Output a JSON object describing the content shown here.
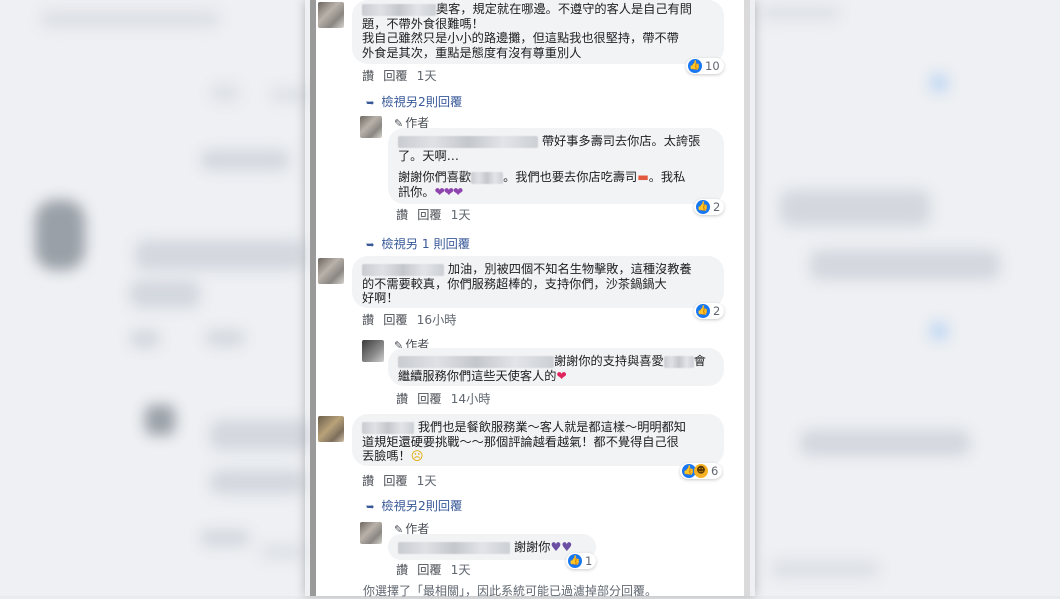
{
  "comments": [
    {
      "text_lines": [
        "奧客，規定就在哪邊。不遵守的客人是自己有問",
        "題，不帶外食很難嗎！",
        "我自己雖然只是小小的路邊攤，但這點我也很堅持，帶不帶",
        "外食是其次，重點是態度有沒有尊重別人"
      ],
      "actions": {
        "like": "讚",
        "reply": "回覆",
        "time": "1天"
      },
      "reaction_count": "10",
      "view_more": "檢視另2則回覆",
      "reply": {
        "author_label": "作者",
        "text_a": "帶好事多壽司去你店。太誇張",
        "text_b": "了。天啊…",
        "text_c": "謝謝你們喜歡",
        "text_d": "。我們也要去你店吃壽司",
        "text_e": "。我私",
        "text_f": "訊你。",
        "actions": {
          "like": "讚",
          "reply": "回覆",
          "time": "1天"
        },
        "reaction_count": "2"
      }
    },
    {
      "text_lines": [
        "加油，別被四個不知名生物擊敗，這種沒教養",
        "的不需要較真，你們服務超棒的，支持你們，沙茶鍋鍋大",
        "好啊！"
      ],
      "actions": {
        "like": "讚",
        "reply": "回覆",
        "time": "16小時"
      },
      "reaction_count": "2",
      "view_more": "檢視另 1 則回覆",
      "reply": {
        "author_label": "作者",
        "text_a": "謝謝你的支持與喜愛",
        "text_a2": "會",
        "text_b": "繼續服務你們這些天使客人的",
        "actions": {
          "like": "讚",
          "reply": "回覆",
          "time": "14小時"
        }
      }
    },
    {
      "text_lines": [
        "我們也是餐飲服務業～客人就是都這樣～明明都知",
        "道規矩還硬要挑戰～～那個評論越看越氣！都不覺得自己很",
        "丟臉嗎！"
      ],
      "actions": {
        "like": "讚",
        "reply": "回覆",
        "time": "1天"
      },
      "reaction_count": "6",
      "view_more": "檢視另2則回覆",
      "reply": {
        "author_label": "作者",
        "text_a": "謝謝你",
        "actions": {
          "like": "讚",
          "reply": "回覆",
          "time": "1天"
        },
        "reaction_count": "1"
      }
    }
  ],
  "footer_text": "你選擇了「最相關」，因此系統可能已過濾掉部分回覆。",
  "icons": {
    "like": "like-icon",
    "haha": "haha-icon",
    "pen": "pencil-icon",
    "arrow": "reply-arrow-icon",
    "heart": "heart-icon",
    "purple_hearts": "purple-heart-icon",
    "sushi": "sushi-icon",
    "emoji": "emoji-face-icon",
    "cats": "cat-emoji-icon"
  },
  "colors": {
    "link": "#385898",
    "like_blue": "#1877f2",
    "bubble": "#f2f3f5"
  }
}
